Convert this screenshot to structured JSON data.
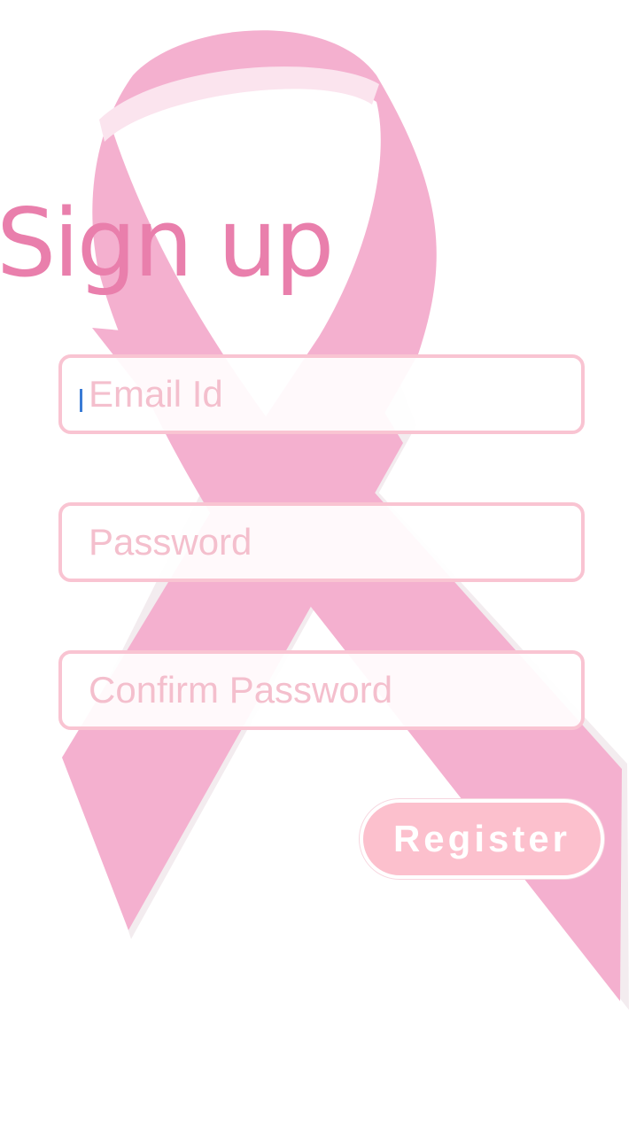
{
  "page": {
    "title": "Sign up"
  },
  "form": {
    "email": {
      "value": "",
      "placeholder": "Email Id"
    },
    "password": {
      "value": "",
      "placeholder": "Password"
    },
    "confirm_password": {
      "value": "",
      "placeholder": "Confirm Password"
    },
    "register_label": "Register"
  },
  "colors": {
    "title": "#e97fac",
    "ribbon": "#f4b0cf",
    "field_border": "#f9c4d2",
    "placeholder": "#f4bfcd",
    "button_bg": "#fcc0cd",
    "caret": "#3a7bd5"
  },
  "icons": {
    "background": "awareness-ribbon-icon"
  }
}
